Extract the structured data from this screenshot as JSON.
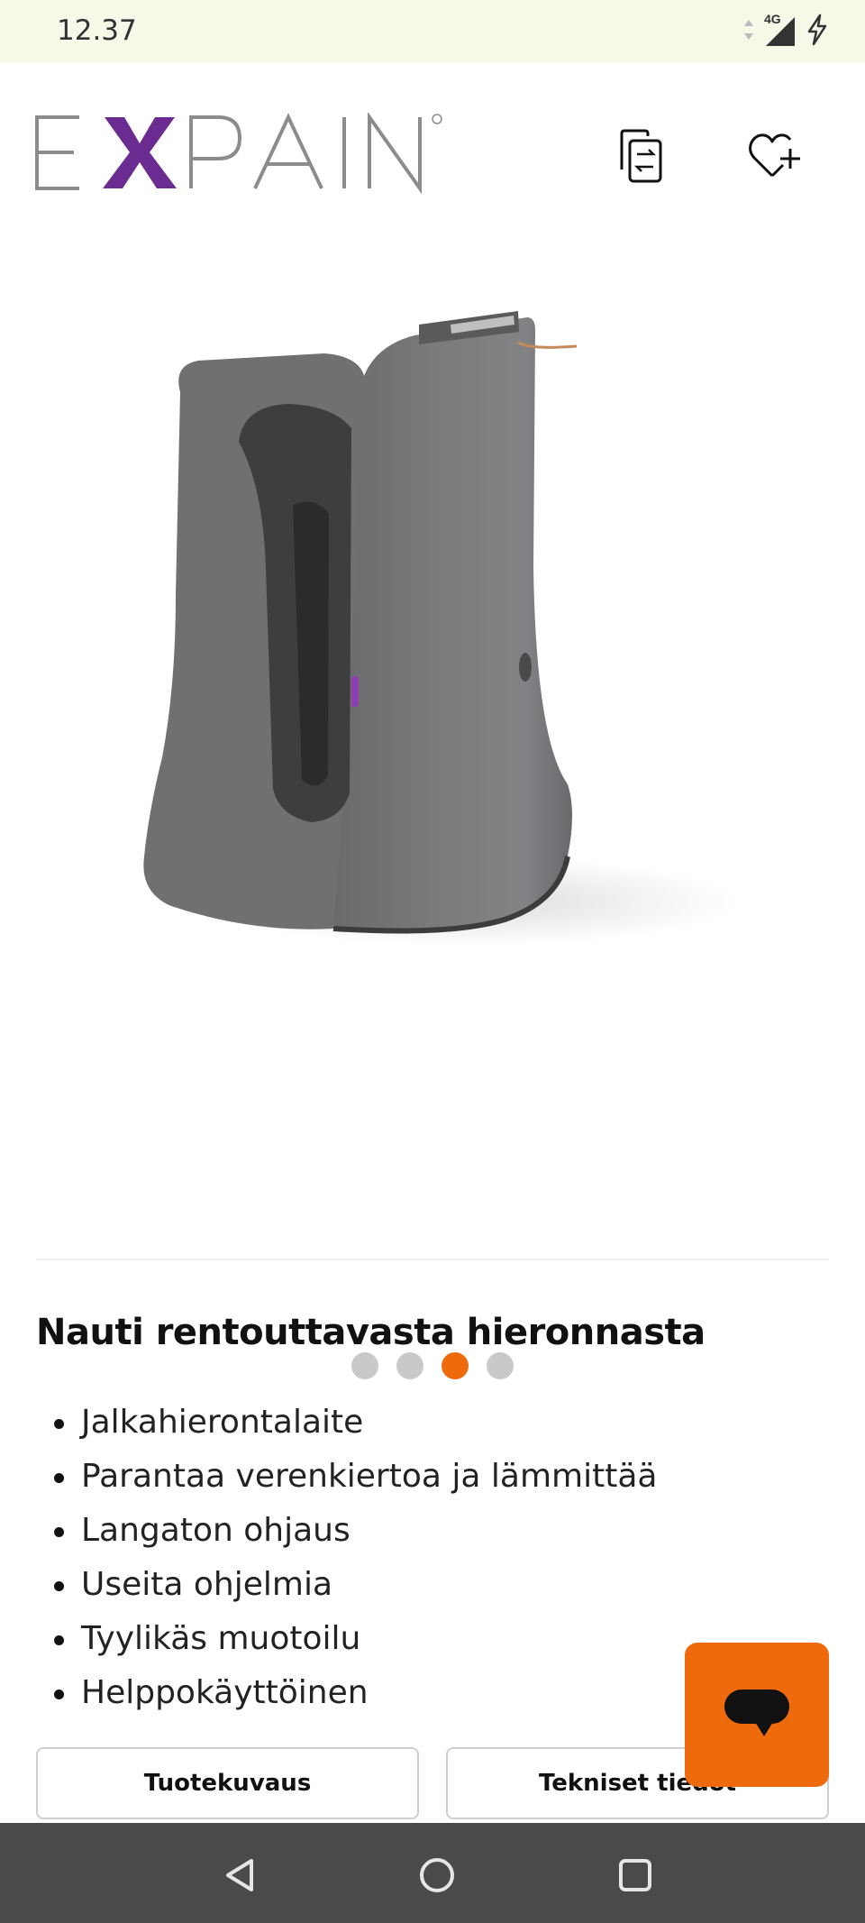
{
  "status_bar": {
    "time": "12.37",
    "network": "4G",
    "icons": [
      "data-arrows-icon",
      "signal-icon",
      "charging-icon"
    ]
  },
  "header": {
    "brand": "EXPAIN",
    "icons": [
      "compare-icon",
      "wishlist-add-icon"
    ]
  },
  "carousel": {
    "slide_count": 4,
    "active_index": 2,
    "image": "foot-massager-product-photo"
  },
  "product": {
    "title": "Nauti rentouttavasta hieronnasta",
    "features": [
      "Jalkahierontalaite",
      "Parantaa verenkiertoa ja lämmittää",
      "Langaton ohjaus",
      "Useita ohjelmia",
      "Tyylikäs muotoilu",
      "Helppokäyttöinen"
    ]
  },
  "tabs": {
    "description_label": "Tuotekuvaus",
    "specs_label": "Tekniset tiedot"
  },
  "chat": {
    "icon": "chat-bubble-icon"
  },
  "nav_bar": {
    "icons": [
      "back-icon",
      "home-icon",
      "recents-icon"
    ]
  },
  "colors": {
    "accent": "#ee6a0d",
    "brand_purple": "#6b2c91",
    "brand_gray": "#8c8c8c",
    "status_bar_bg": "#f6f8e8",
    "nav_bar_bg": "#4a4a4a"
  }
}
